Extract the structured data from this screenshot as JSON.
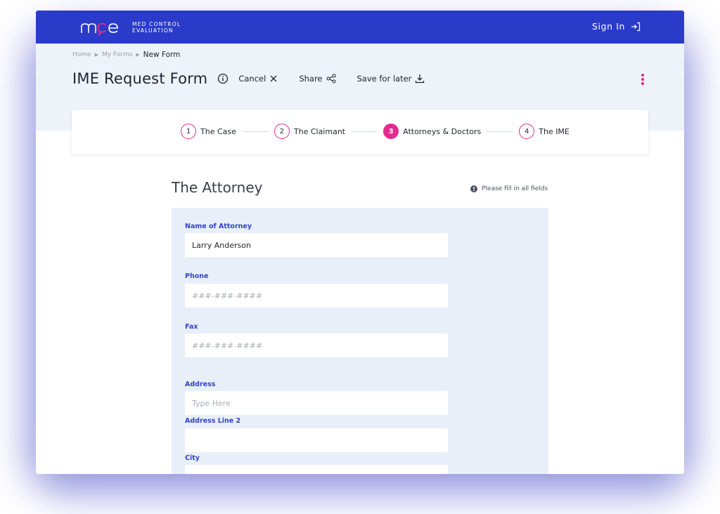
{
  "brand": {
    "name_line1": "MED CONTROL",
    "name_line2": "EVALUATION",
    "logo_text": "mce"
  },
  "topbar": {
    "signin_label": "Sign In"
  },
  "breadcrumb": {
    "items": [
      "Home",
      "My Forms"
    ],
    "current": "New Form"
  },
  "page": {
    "title": "IME Request Form"
  },
  "actions": {
    "cancel": "Cancel",
    "share": "Share",
    "save_later": "Save for later"
  },
  "steps": [
    {
      "num": "1",
      "label": "The Case"
    },
    {
      "num": "2",
      "label": "The Claimant"
    },
    {
      "num": "3",
      "label": "Attorneys & Doctors"
    },
    {
      "num": "4",
      "label": "The IME"
    }
  ],
  "section": {
    "title": "The Attorney",
    "note": "Please fill in all fields"
  },
  "fields": {
    "name": {
      "label": "Name of Attorney",
      "value": "Larry Anderson"
    },
    "phone": {
      "label": "Phone",
      "placeholder": "###-###-####"
    },
    "fax": {
      "label": "Fax",
      "placeholder": "###-###-####"
    },
    "address": {
      "label": "Address",
      "placeholder": "Type Here"
    },
    "address2": {
      "label": "Address Line 2"
    },
    "city": {
      "label": "City"
    }
  },
  "colors": {
    "primary": "#2b3bc9",
    "accent": "#e42a8f",
    "panel": "#e8eff9"
  },
  "icons": [
    "info-icon",
    "close-icon",
    "share-icon",
    "download-icon",
    "sign-in-icon",
    "more-vertical-icon"
  ]
}
